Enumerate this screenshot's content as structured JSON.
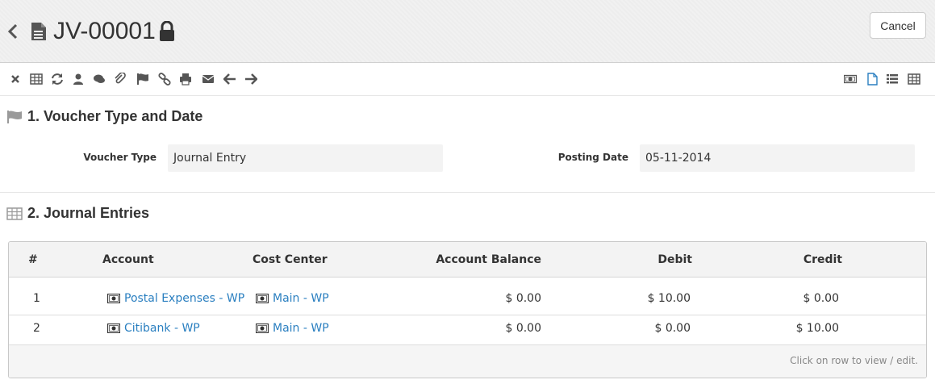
{
  "header": {
    "title": "JV-00001",
    "cancel_label": "Cancel"
  },
  "toolbar": {
    "left_icons": [
      "close-icon",
      "table-icon",
      "refresh-icon",
      "user-icon",
      "comments-icon",
      "paperclip-icon",
      "flag-icon",
      "link-icon",
      "print-icon",
      "envelope-icon",
      "arrow-left-icon",
      "arrow-right-icon"
    ],
    "right_icons": [
      "money-icon",
      "file-icon",
      "list-icon",
      "table-icon"
    ]
  },
  "section1": {
    "title": "1. Voucher Type and Date",
    "voucher_type_label": "Voucher Type",
    "voucher_type_value": "Journal Entry",
    "posting_date_label": "Posting Date",
    "posting_date_value": "05-11-2014"
  },
  "section2": {
    "title": "2. Journal Entries",
    "columns": {
      "no": "#",
      "account": "Account",
      "cost_center": "Cost Center",
      "account_balance": "Account Balance",
      "debit": "Debit",
      "credit": "Credit"
    },
    "rows": [
      {
        "no": "1",
        "account": "Postal Expenses - WP",
        "cost_center": "Main - WP",
        "account_balance": "$ 0.00",
        "debit": "$ 10.00",
        "credit": "$ 0.00"
      },
      {
        "no": "2",
        "account": "Citibank - WP",
        "cost_center": "Main - WP",
        "account_balance": "$ 0.00",
        "debit": "$ 0.00",
        "credit": "$ 10.00"
      }
    ],
    "footer_hint": "Click on row to view / edit."
  },
  "colors": {
    "link": "#2a7fc0",
    "toolbar_icon": "#555555",
    "active_icon": "#2a7fc0",
    "section_icon": "#9a9a9a"
  }
}
